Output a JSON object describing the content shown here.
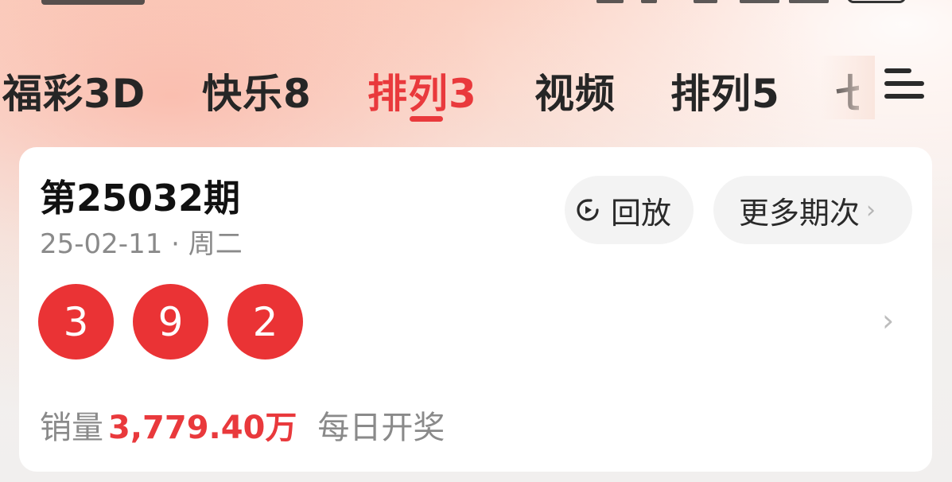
{
  "tabs": [
    {
      "label": "福彩3D",
      "active": false
    },
    {
      "label": "快乐8",
      "active": false
    },
    {
      "label": "排列3",
      "active": true
    },
    {
      "label": "视频",
      "active": false
    },
    {
      "label": "排列5",
      "active": false
    },
    {
      "label": "七",
      "active": false
    }
  ],
  "card": {
    "issue_title": "第25032期",
    "draw_date": "25-02-11 · 周二",
    "replay_label": "回放",
    "more_label": "更多期次",
    "balls": [
      "3",
      "9",
      "2"
    ],
    "sales_label": "销量",
    "sales_value": "3,779.40万",
    "schedule": "每日开奖"
  },
  "icons": {
    "replay": "replay-icon",
    "more": "chevron-right-icon",
    "menu": "hamburger-menu-icon"
  },
  "colors": {
    "accent": "#e9393c",
    "ball": "#ea3335",
    "card_background": "#ffffff"
  }
}
